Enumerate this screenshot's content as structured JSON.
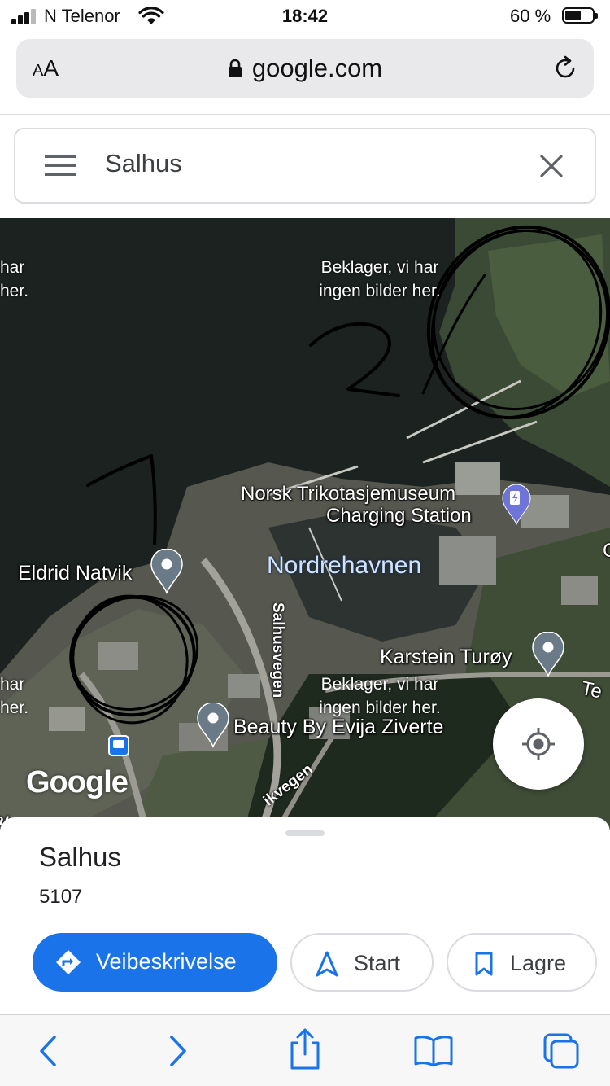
{
  "status_bar": {
    "carrier": "N Telenor",
    "time": "18:42",
    "battery_percent_label": "60 %",
    "battery_level": 0.6
  },
  "browser": {
    "text_size_label_small": "A",
    "text_size_label_large": "A",
    "url": "google.com"
  },
  "search": {
    "query": "Salhus"
  },
  "map": {
    "no_imagery_message_lines": [
      "Beklager, vi har",
      "ingen bilder her."
    ],
    "partial_no_imagery_lines": [
      "har",
      "her."
    ],
    "area_label": "Nordrehavnen",
    "roads": [
      "Salhusvegen",
      "ikvegen"
    ],
    "edge_fragments": [
      "Te",
      "C",
      "alt"
    ],
    "places": [
      {
        "name": "Eldrid Natvik",
        "icon": "map-pin-icon"
      },
      {
        "name": "Norsk Trikotasjemuseum",
        "icon": "ev-charging-icon"
      },
      {
        "name": "Charging Station",
        "icon": "ev-charging-icon"
      },
      {
        "name": "Karstein Turøy",
        "icon": "map-pin-icon"
      },
      {
        "name": "Beauty By Evija Ziverte",
        "icon": "map-pin-icon"
      }
    ],
    "bus_stop_icon": "bus-stop-icon",
    "logo_text": "Google",
    "annotation_colors": {
      "ink": "#000000"
    },
    "handwritten_annotations": [
      "1",
      "2"
    ]
  },
  "place_sheet": {
    "title": "Salhus",
    "postcode": "5107",
    "actions": {
      "directions": "Veibeskrivelse",
      "start": "Start",
      "save": "Lagre"
    }
  },
  "colors": {
    "accent": "#1a73e8",
    "pin": "#6b7a87",
    "ev_pin": "#6f74d9"
  }
}
